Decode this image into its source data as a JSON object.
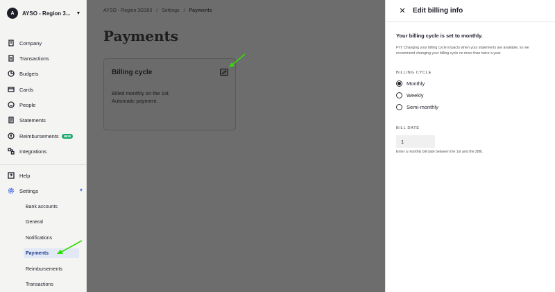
{
  "sidebar": {
    "org_initial": "A",
    "org_name": "AYSO - Region 3...",
    "items": [
      {
        "label": "Company",
        "icon": "building-icon"
      },
      {
        "label": "Transactions",
        "icon": "receipt-icon"
      },
      {
        "label": "Budgets",
        "icon": "budget-icon"
      },
      {
        "label": "Cards",
        "icon": "card-icon"
      },
      {
        "label": "People",
        "icon": "smile-icon"
      },
      {
        "label": "Statements",
        "icon": "statement-icon"
      },
      {
        "label": "Reimbursements",
        "icon": "reimburse-icon",
        "badge": "NEW"
      },
      {
        "label": "Integrations",
        "icon": "integrations-icon"
      }
    ],
    "help_label": "Help",
    "settings_label": "Settings",
    "settings_sub": [
      "Bank accounts",
      "General",
      "Notifications",
      "Payments",
      "Reimbursements",
      "Transactions"
    ],
    "active_sub": "Payments"
  },
  "main": {
    "breadcrumb": [
      "AYSO - Region 3G383",
      "/",
      "Settings",
      "/",
      "Payments"
    ],
    "title": "Payments",
    "card": {
      "title": "Billing cycle",
      "line1": "Billed monthly on the 1st.",
      "line2": "Automatic payment."
    }
  },
  "panel": {
    "title": "Edit billing info",
    "heading": "Your billing cycle is set to monthly.",
    "fyi": "FYI: Changing your billing cycle impacts when your statements are available, so we recommend changing your billing cycle no more than twice a year.",
    "cycle_label": "BILLING CYCLE",
    "options": [
      "Monthly",
      "Weekly",
      "Semi-monthly"
    ],
    "selected_option": "Monthly",
    "date_label": "BILL DATE",
    "date_value": "1",
    "date_hint": "Enter a monthly bill date between the 1st and the 28th."
  },
  "colors": {
    "overlay": "#6d6d6d",
    "accent": "#3a5bd9",
    "badge": "#17a96c",
    "annotation_arrow": "#2ee000"
  }
}
